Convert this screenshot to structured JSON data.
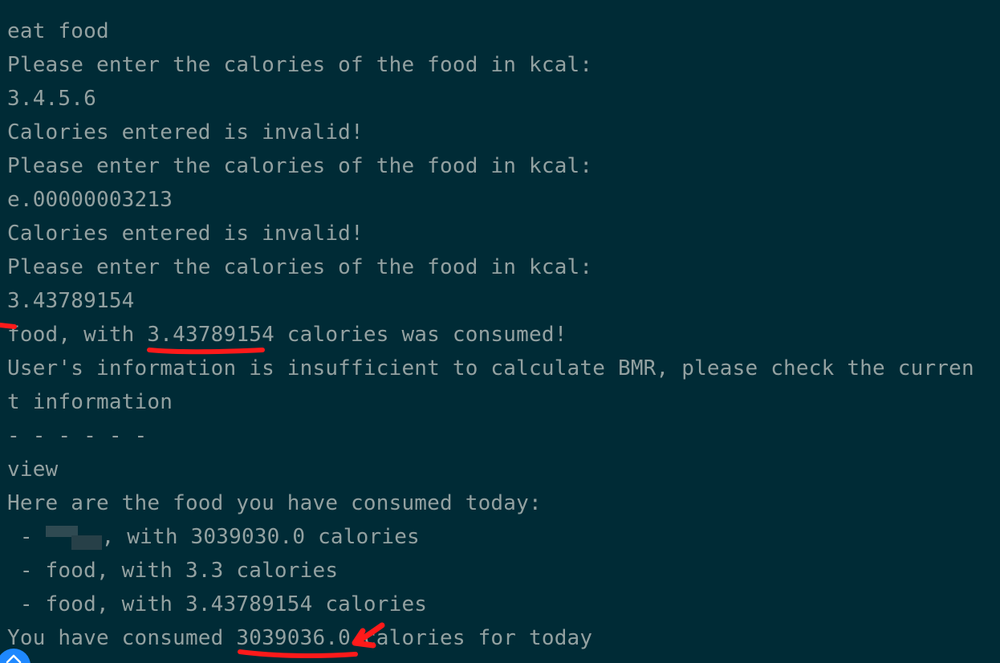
{
  "terminal": {
    "lines": [
      "eat food",
      "Please enter the calories of the food in kcal:",
      "3.4.5.6",
      "Calories entered is invalid!",
      "Please enter the calories of the food in kcal:",
      "e.00000003213",
      "Calories entered is invalid!",
      "Please enter the calories of the food in kcal:",
      "3.43789154",
      "food, with 3.43789154 calories was consumed!",
      "User's information is insufficient to calculate BMR, please check the curren",
      "t information",
      "- - - - - -",
      "view",
      "Here are the food you have consumed today:",
      "with 3039030.0 calories",
      " - food, with 3.3 calories",
      " - food, with 3.43789154 calories",
      "You have consumed 3039036.0 calories for today"
    ],
    "redacted_prefix": " - ",
    "redacted_suffix": ", "
  },
  "colors": {
    "background": "#002b36",
    "text": "#93a1a1",
    "annotation": "#ff1a1a",
    "scroll_button": "#1e88ff"
  },
  "icons": {
    "scroll_button": "chevron-up-icon"
  }
}
